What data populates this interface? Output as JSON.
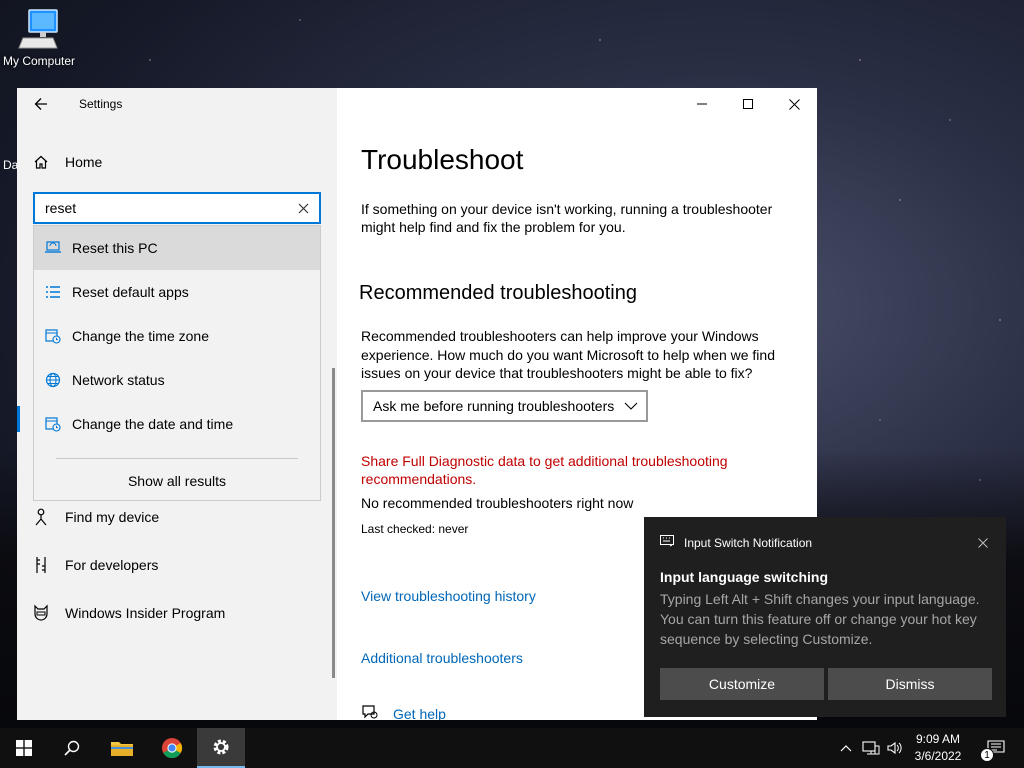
{
  "desktop": {
    "icon_label": "My Computer",
    "partial_label": "Da"
  },
  "window": {
    "title": "Settings",
    "home_label": "Home",
    "search": {
      "value": "reset",
      "results": [
        {
          "label": "Reset this PC",
          "icon": "laptop-reset-icon"
        },
        {
          "label": "Reset default apps",
          "icon": "list-apps-icon"
        },
        {
          "label": "Change the time zone",
          "icon": "clock-calendar-icon"
        },
        {
          "label": "Network status",
          "icon": "globe-icon"
        },
        {
          "label": "Change the date and time",
          "icon": "clock-calendar-icon"
        }
      ],
      "show_all": "Show all results"
    },
    "nav": {
      "find_my_device": "Find my device",
      "for_developers": "For developers",
      "insider": "Windows Insider Program"
    },
    "content": {
      "title": "Troubleshoot",
      "intro": "If something on your device isn't working, running a troubleshooter might help find and fix the problem for you.",
      "recommended_heading": "Recommended troubleshooting",
      "recommended_desc": "Recommended troubleshooters can help improve your Windows experience. How much do you want Microsoft to help when we find issues on your device that troubleshooters might be able to fix?",
      "select_value": "Ask me before running troubleshooters",
      "diagnostic_link": "Share Full Diagnostic data to get additional troubleshooting recommendations.",
      "no_recommended": "No recommended troubleshooters right now",
      "last_checked": "Last checked: never",
      "history_link": "View troubleshooting history",
      "additional_link": "Additional troubleshooters",
      "get_help": "Get help"
    }
  },
  "notification": {
    "app": "Input Switch Notification",
    "title": "Input language switching",
    "body": "Typing Left Alt + Shift changes your input language. You can turn this feature off or change your hot key sequence by selecting Customize.",
    "customize": "Customize",
    "dismiss": "Dismiss"
  },
  "taskbar": {
    "time": "9:09 AM",
    "date": "3/6/2022",
    "notification_count": "1"
  },
  "colors": {
    "accent": "#0078d7",
    "link": "#0067b8",
    "warning_link": "#c00000",
    "toast_bg": "#1f1f1f"
  }
}
